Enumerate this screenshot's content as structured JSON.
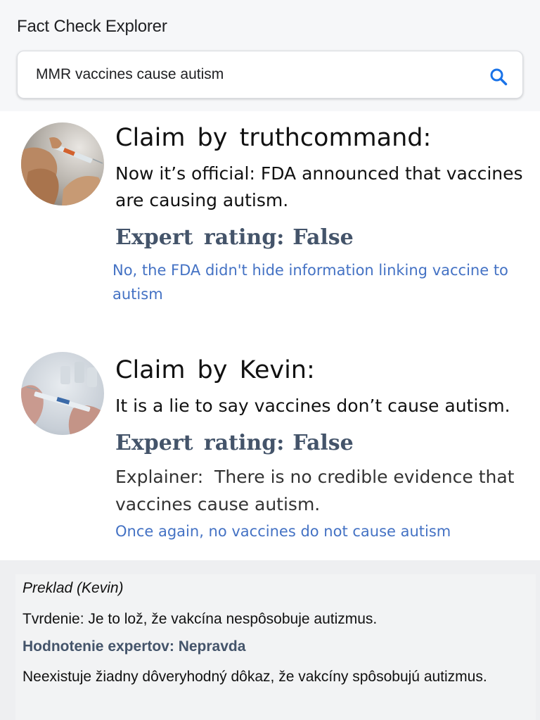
{
  "app": {
    "title": "Fact Check Explorer"
  },
  "search": {
    "query": "MMR vaccines cause autism",
    "icon": "search-icon"
  },
  "results": [
    {
      "avatar": "vaccine-syringe-photo",
      "claim_title": "Claim by truthcommand:",
      "claim_text": "Now it’s official: FDA announced that vaccines are causing autism.",
      "rating_label": "Expert rating:",
      "rating_value": "False",
      "link_text": "No, the FDA didn't hide information linking vaccine to autism"
    },
    {
      "avatar": "vaccine-vial-syringe-photo",
      "claim_title": "Claim by Kevin:",
      "claim_text": "It is a lie to say vaccines don’t cause autism.",
      "rating_label": "Expert rating:",
      "rating_value": "False",
      "explainer": "Explainer:  There is no credible evidence that vaccines cause autism.",
      "link_text": "Once again, no vaccines do not cause autism"
    }
  ],
  "translation": {
    "heading": "Preklad (Kevin)",
    "claim": "Tvrdenie: Je to lož, že vakcína nespôsobuje autizmus.",
    "rating": "Hodnotenie expertov: Nepravda",
    "explainer": "Neexistuje žiadny dôveryhodný dôkaz, že vakcíny spôsobujú autizmus."
  },
  "colors": {
    "rating": "#44546a",
    "link": "#4472c4",
    "search_icon": "#1a73e8",
    "header_bg": "#f6f7f9",
    "translation_bg": "#eeeff1"
  }
}
